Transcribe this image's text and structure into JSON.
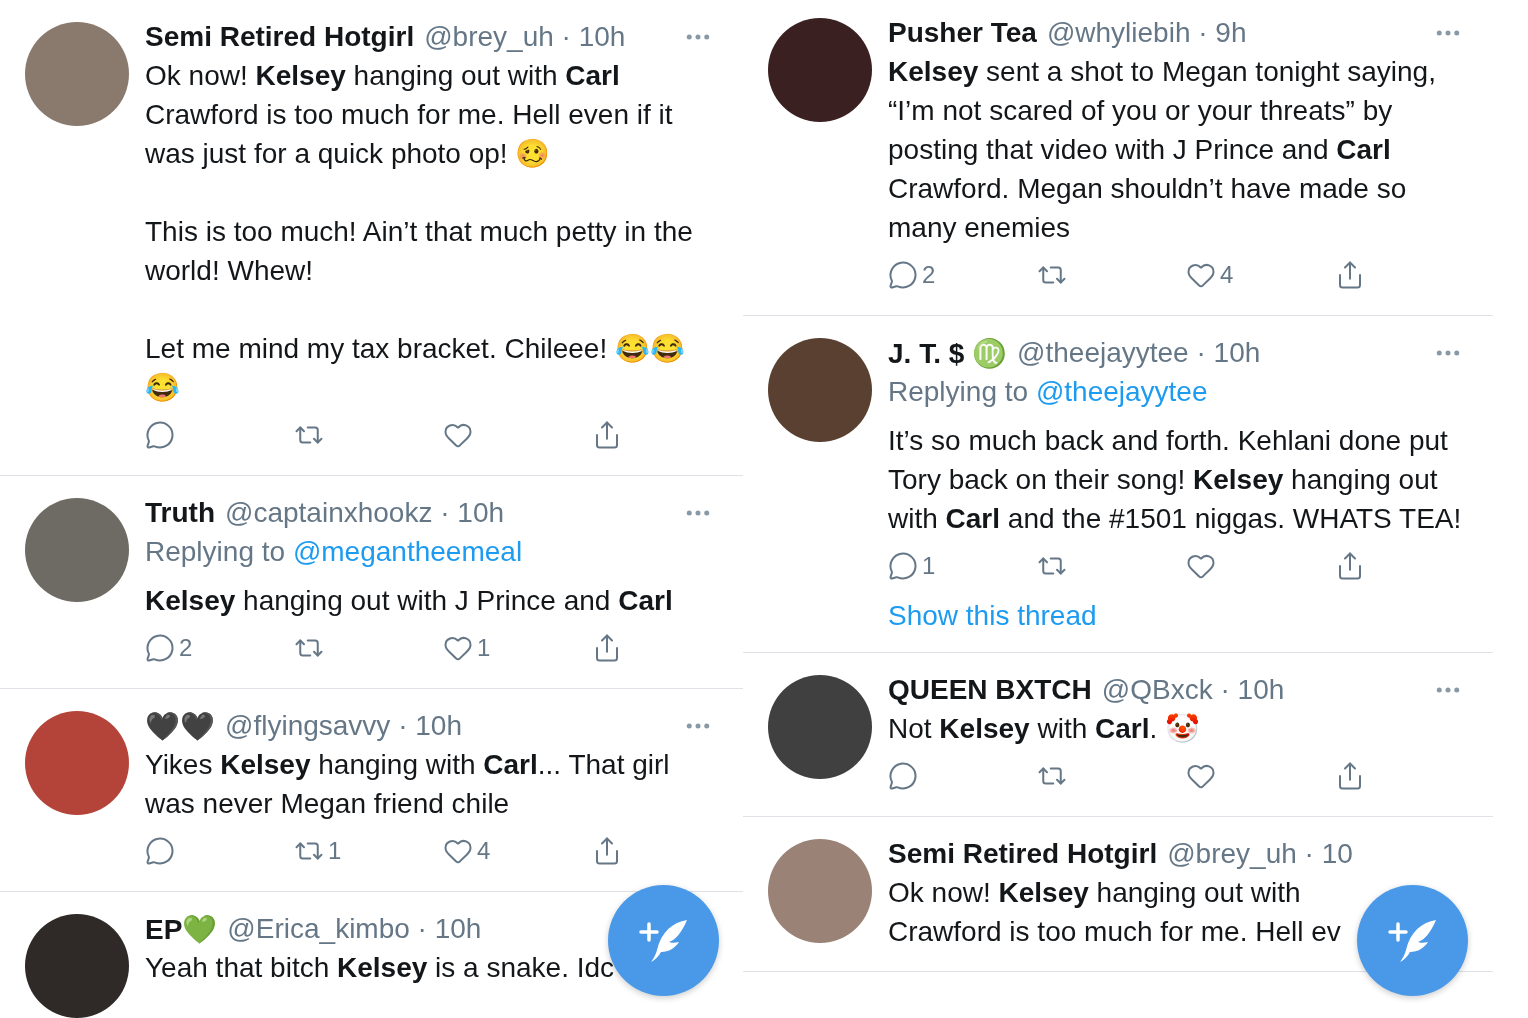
{
  "columns": [
    {
      "tweets": [
        {
          "name": "Semi Retired Hotgirl",
          "handle_line": "@brey_uh · 10h",
          "body": [
            "Ok now! **Kelsey** hanging out with **Carl** Crawford is too much for me. Hell even if it was just for a quick photo op! 🥴",
            "This is too much! Ain’t that much petty in the world! Whew!",
            "Let me mind my tax bracket. Chileee! 😂😂😂"
          ],
          "actions": [
            {
              "kind": "reply"
            },
            {
              "kind": "retweet"
            },
            {
              "kind": "like"
            },
            {
              "kind": "share"
            }
          ]
        },
        {
          "name": "Truth",
          "handle_line": "@captainxhookz · 10h",
          "replying_to": {
            "label": "Replying to",
            "handle": "@megantheemeal"
          },
          "body": [
            "**Kelsey** hanging out with J Prince and **Carl**"
          ],
          "actions": [
            {
              "kind": "reply",
              "count": "2"
            },
            {
              "kind": "retweet"
            },
            {
              "kind": "like",
              "count": "1"
            },
            {
              "kind": "share"
            }
          ]
        },
        {
          "name": "🖤🖤",
          "handle_line": "@flyingsavvy · 10h",
          "body": [
            "Yikes **Kelsey** hanging with **Carl**... That girl was never Megan friend chile"
          ],
          "actions": [
            {
              "kind": "reply"
            },
            {
              "kind": "retweet",
              "count": "1"
            },
            {
              "kind": "like",
              "count": "4"
            },
            {
              "kind": "share"
            }
          ]
        },
        {
          "name": "EP💚",
          "handle_line": "@Erica_kimbo · 10h",
          "lines": [
            "Yeah that bitch **Kelsey** is a snake. Idc"
          ]
        }
      ]
    },
    {
      "tweets": [
        {
          "name": "Pusher Tea",
          "handle_line": "@whyliebih · 9h",
          "body": [
            "**Kelsey** sent a shot to Megan tonight saying, “I’m not scared of you or your threats” by posting that video with J Prince and **Carl** Crawford. Megan shouldn’t have made so many enemies"
          ],
          "actions": [
            {
              "kind": "reply",
              "count": "2"
            },
            {
              "kind": "retweet"
            },
            {
              "kind": "like",
              "count": "4"
            },
            {
              "kind": "share"
            }
          ]
        },
        {
          "name": "J. T.  $ ♍",
          "handle_line": "@theejayytee · 10h",
          "replying_to": {
            "label": "Replying to",
            "handle": "@theejayytee"
          },
          "body": [
            "It’s so much back and forth. Kehlani done put Tory back on their song! **Kelsey** hanging out with **Carl** and the #1501 niggas. WHATS TEA!"
          ],
          "actions": [
            {
              "kind": "reply",
              "count": "1"
            },
            {
              "kind": "retweet"
            },
            {
              "kind": "like"
            },
            {
              "kind": "share"
            }
          ],
          "show_thread": "Show this thread"
        },
        {
          "name": "QUEEN BXTCH",
          "handle_line": "@QBxck · 10h",
          "body": [
            "Not **Kelsey** with **Carl**. 🤡"
          ],
          "actions": [
            {
              "kind": "reply"
            },
            {
              "kind": "retweet"
            },
            {
              "kind": "like"
            },
            {
              "kind": "share"
            }
          ]
        },
        {
          "name": "Semi Retired Hotgirl",
          "handle_line": "@brey_uh · 10",
          "lines": [
            "Ok now! **Kelsey** hanging out with",
            "Crawford is too much for me. Hell ev"
          ]
        }
      ]
    }
  ]
}
